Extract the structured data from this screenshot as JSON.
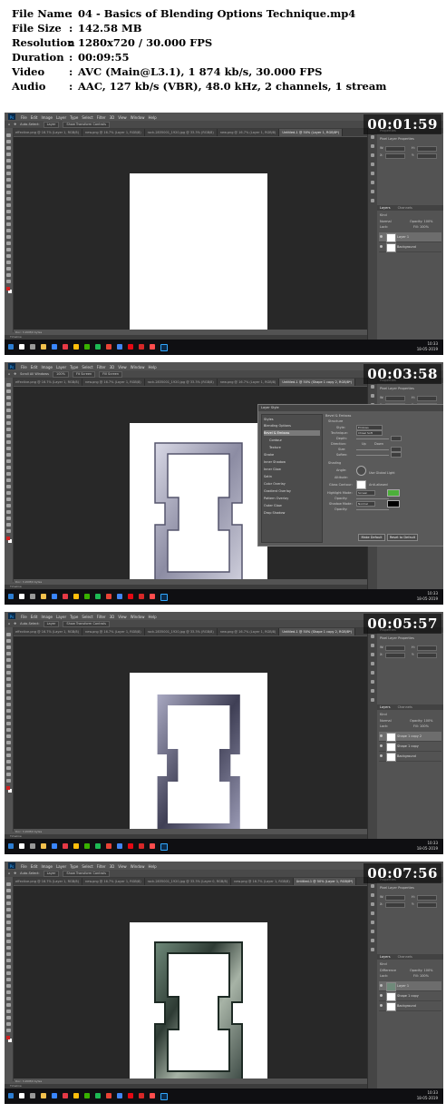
{
  "info": {
    "rows": [
      {
        "key": "File Name",
        "value": "04 - Basics of Blending Options Technique.mp4"
      },
      {
        "key": "File Size",
        "value": "142.58 MB"
      },
      {
        "key": "Resolution",
        "value": "1280x720 / 30.000 FPS"
      },
      {
        "key": "Duration",
        "value": "00:09:55"
      },
      {
        "key": "Video",
        "value": "AVC (Main@L3.1), 1 874 kb/s, 30.000 FPS"
      },
      {
        "key": "Audio",
        "value": "AAC, 127 kb/s (VBR), 48.0 kHz, 2 channels, 1 stream"
      }
    ]
  },
  "app": {
    "menu": [
      "Ps",
      "File",
      "Edit",
      "Image",
      "Layer",
      "Type",
      "Select",
      "Filter",
      "3D",
      "View",
      "Window",
      "Help"
    ],
    "options_move": [
      "Auto-Select:",
      "Layer",
      "Show Transform Controls"
    ],
    "options_scroll": [
      "Scroll All Windows",
      "100%",
      "Fit Screen",
      "Fill Screen"
    ],
    "status": "Doc: 3.20M/0 bytes",
    "timeline": "Timeline",
    "panels": {
      "properties": "Properties",
      "pixel_layer": "Pixel Layer Properties",
      "w": "W:",
      "h": "H:",
      "x": "X:",
      "y": "Y:",
      "layers_tab": "Layers",
      "channels_tab": "Channels",
      "kind": "Kind",
      "normal": "Normal",
      "opacity": "Opacity: 100%",
      "lock": "Lock:",
      "fill": "Fill: 100%",
      "difference": "Difference"
    },
    "taskbar_time": "10:33",
    "taskbar_date": "18-05-2019"
  },
  "frames": [
    {
      "timestamp": "00:01:59",
      "tabs": [
        "effective.png @ 16.7% (Layer 1, RGB/8)",
        "new.png @ 16.7% (Layer 1, RGB/8)",
        "rock-2835001_1920.jpg @ 33.3% (RGB/8)",
        "new.png @ 16.7% (Layer 1, RGB/8)",
        "Untitled-1 @ 50% (Layer 1, RGB/8*)"
      ],
      "layers": [
        "Layer 1",
        "Background"
      ]
    },
    {
      "timestamp": "00:03:58",
      "tabs": [
        "effective.png @ 16.7% (Layer 1, RGB/8)",
        "new.png @ 16.7% (Layer 1, RGB/8)",
        "rock-2835001_1920.jpg @ 33.3% (RGB/8)",
        "new.png @ 16.7% (Layer 1, RGB/8)",
        "Untitled-1 @ 50% (Shape 1 copy 2, RGB/8*)"
      ],
      "layers": [
        "Shape 1 copy 2",
        "Shape 1 copy",
        "Background"
      ],
      "dialog": {
        "title": "Layer Style",
        "styles_header": "Styles",
        "blending_options": "Blending Options",
        "effects": [
          "Bevel & Emboss",
          "Contour",
          "Texture",
          "Stroke",
          "Inner Shadow",
          "Inner Glow",
          "Satin",
          "Color Overlay",
          "Gradient Overlay",
          "Pattern Overlay",
          "Outer Glow",
          "Drop Shadow"
        ],
        "section": "Bevel & Emboss",
        "structure": "Structure",
        "style_label": "Style:",
        "style_value": "Emboss",
        "technique_label": "Technique:",
        "technique_value": "Chisel Soft",
        "depth_label": "Depth:",
        "direction_label": "Direction:",
        "up": "Up",
        "down": "Down",
        "size_label": "Size:",
        "soften_label": "Soften:",
        "shading": "Shading",
        "angle_label": "Angle:",
        "use_global": "Use Global Light",
        "altitude_label": "Altitude:",
        "gloss_label": "Gloss Contour:",
        "anti_aliased": "Anti-aliased",
        "highlight_label": "Highlight Mode:",
        "screen": "Screen",
        "opacity_label": "Opacity:",
        "shadow_label": "Shadow Mode:",
        "normal": "Normal",
        "make_default": "Make Default",
        "reset_default": "Reset to Default"
      }
    },
    {
      "timestamp": "00:05:57",
      "tabs": [
        "effective.png @ 16.7% (Layer 1, RGB/8)",
        "new.png @ 16.7% (Layer 1, RGB/8)",
        "rock-2835001_1920.jpg @ 33.3% (RGB/8)",
        "new.png @ 16.7% (Layer 1, RGB/8)",
        "Untitled-1 @ 50% (Shape 1 copy 2, RGB/8*)"
      ],
      "layers": [
        "Shape 1 copy 2",
        "Shape 1 copy",
        "Background"
      ]
    },
    {
      "timestamp": "00:07:56",
      "tabs": [
        "effective.png @ 16.7% (Layer 1, RGB/8)",
        "new.png @ 16.7% (Layer 1, RGB/8)",
        "rock-2835001_1920.jpg @ 33.3% (Layer 0, RGB/8)",
        "new.png @ 16.7% (Layer 1, RGB/8)",
        "Untitled-1 @ 50% (Layer 1, RGB/8*)"
      ],
      "layers": [
        "Layer 1",
        "Shape 1 copy",
        "Background"
      ]
    }
  ]
}
